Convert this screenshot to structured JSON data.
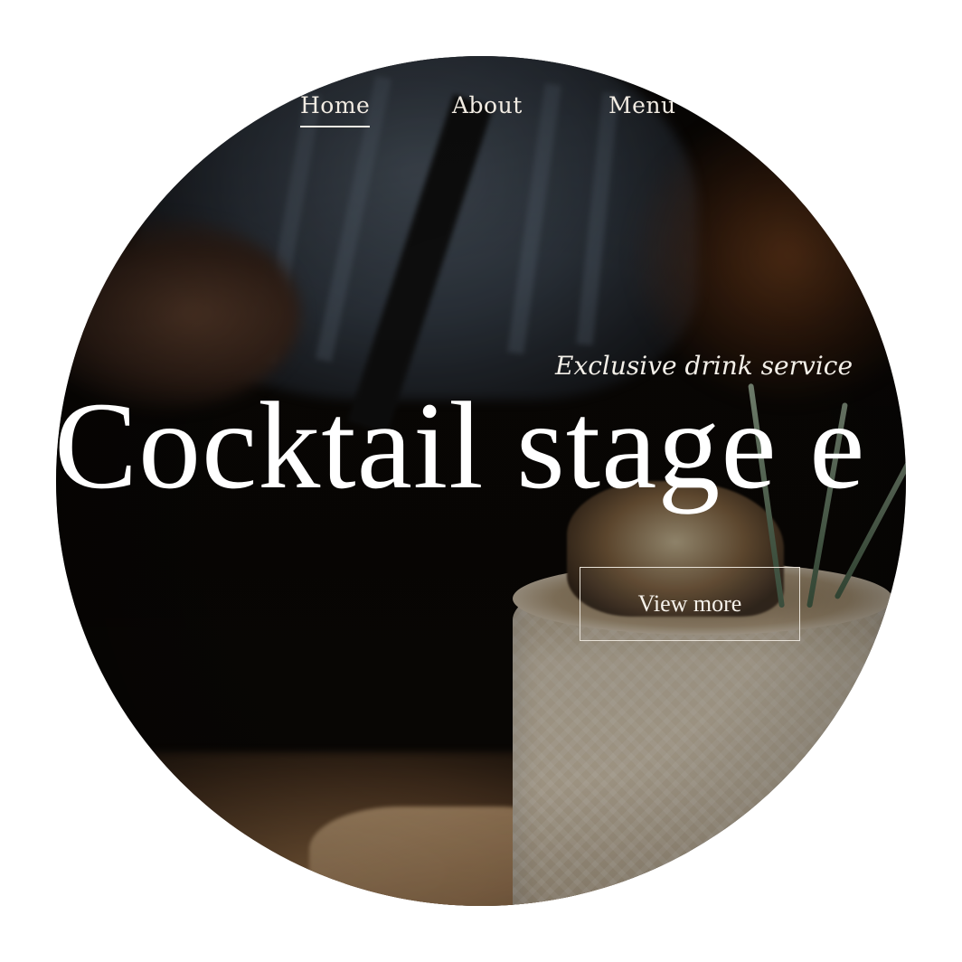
{
  "nav": {
    "items": [
      {
        "label": "Home",
        "active": true
      },
      {
        "label": "About",
        "active": false
      },
      {
        "label": "Menu",
        "active": false
      }
    ]
  },
  "hero": {
    "tagline": "Exclusive drink service",
    "headline": "Cocktail stage e",
    "cta_label": "View more"
  },
  "colors": {
    "text": "#ffffff",
    "background": "#0b0805"
  }
}
